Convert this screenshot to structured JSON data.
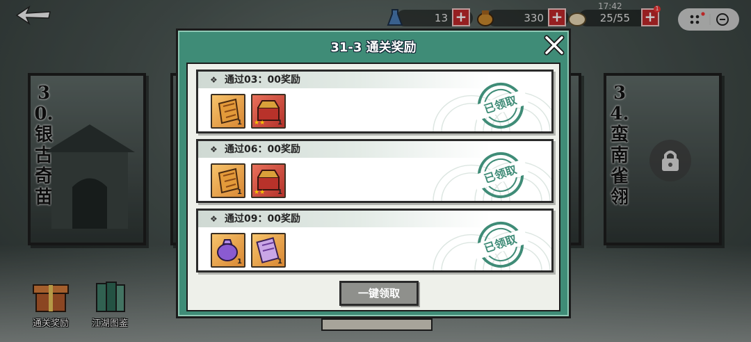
{
  "status_bar": {
    "time": "17:42",
    "notification_count": "1"
  },
  "resources": [
    {
      "name": "stamina",
      "value": "13",
      "icon": "blue-bottle-icon"
    },
    {
      "name": "gold",
      "value": "330",
      "icon": "coin-pouch-icon"
    },
    {
      "name": "food",
      "value": "25/55",
      "icon": "bun-icon"
    }
  ],
  "stages": {
    "left_title": "30.银古奇苗",
    "right_title": "34.蛮南雀翎"
  },
  "bottom_nav": {
    "clear_rewards_label": "通关奖励",
    "jianghu_atlas_label": "江湖图鉴"
  },
  "modal": {
    "title": "31-3 通关奖励",
    "claim_all_label": "一键领取",
    "rows": [
      {
        "heading": "通过03：00奖励",
        "stamp": "已领取",
        "items": [
          {
            "icon": "scroll-talisman-icon",
            "count": "1",
            "stars": ""
          },
          {
            "icon": "treasure-chest-icon",
            "count": "1",
            "stars": "★★"
          }
        ]
      },
      {
        "heading": "通过06：00奖励",
        "stamp": "已领取",
        "items": [
          {
            "icon": "scroll-talisman-icon",
            "count": "1",
            "stars": ""
          },
          {
            "icon": "treasure-chest-icon",
            "count": "1",
            "stars": "★★"
          }
        ]
      },
      {
        "heading": "通过09：00奖励",
        "stamp": "已领取",
        "items": [
          {
            "icon": "purple-pouch-icon",
            "count": "1",
            "stars": ""
          },
          {
            "icon": "purple-scroll-icon",
            "count": "1",
            "stars": ""
          }
        ]
      }
    ]
  },
  "colors": {
    "modal_green": "#3f8c77",
    "plus_red": "#c0282b",
    "claim_button_gray": "#8f908c"
  }
}
